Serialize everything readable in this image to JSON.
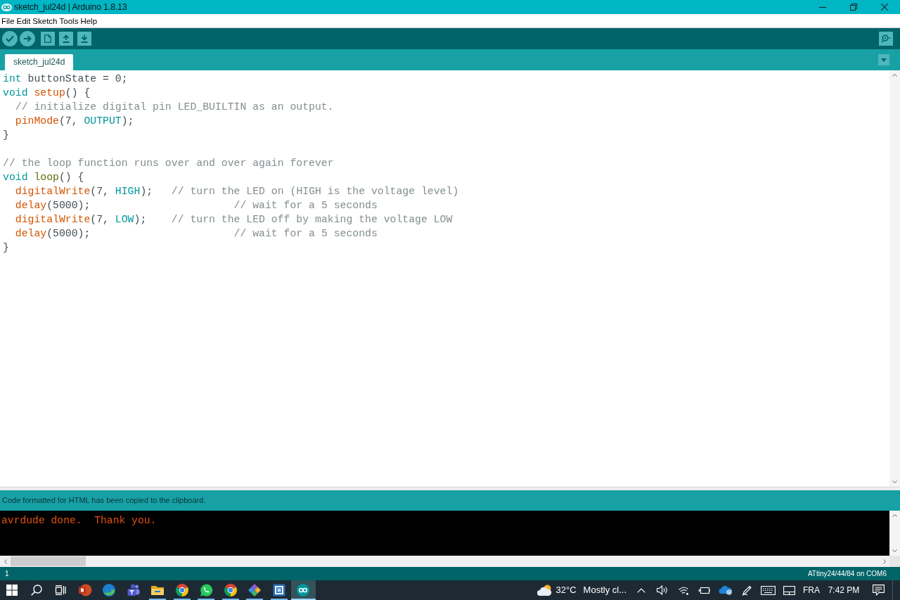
{
  "window": {
    "title": "sketch_jul24d | Arduino 1.8.13"
  },
  "menu": [
    "File",
    "Edit",
    "Sketch",
    "Tools",
    "Help"
  ],
  "tabs": [
    {
      "label": "sketch_jul24d",
      "selected": true
    }
  ],
  "editor": {
    "lines": [
      {
        "kind": "code",
        "tokens": [
          {
            "kind": "type",
            "text": "int"
          },
          {
            "kind": "plain",
            "text": " buttonState = 0;"
          }
        ]
      },
      {
        "kind": "code",
        "tokens": [
          {
            "kind": "type",
            "text": "void "
          },
          {
            "kind": "function",
            "text": "setup"
          },
          {
            "kind": "plain",
            "text": "() {"
          }
        ]
      },
      {
        "kind": "code",
        "tokens": [
          {
            "kind": "comment",
            "text": "  // initialize digital pin LED_BUILTIN as an output."
          }
        ]
      },
      {
        "kind": "code",
        "tokens": [
          {
            "kind": "function",
            "text": "  pinMode"
          },
          {
            "kind": "plain",
            "text": "(7, "
          },
          {
            "kind": "constant",
            "text": "OUTPUT"
          },
          {
            "kind": "plain",
            "text": ");"
          }
        ]
      },
      {
        "kind": "code",
        "tokens": [
          {
            "kind": "plain",
            "text": "}"
          }
        ]
      },
      {
        "kind": "blank"
      },
      {
        "kind": "code",
        "tokens": [
          {
            "kind": "comment",
            "text": "// the loop function runs over and over again forever"
          }
        ]
      },
      {
        "kind": "code",
        "tokens": [
          {
            "kind": "type",
            "text": "void "
          },
          {
            "kind": "structure",
            "text": "loop"
          },
          {
            "kind": "plain",
            "text": "() {"
          }
        ]
      },
      {
        "kind": "code",
        "tokens": [
          {
            "kind": "function",
            "text": "  digitalWrite"
          },
          {
            "kind": "plain",
            "text": "(7, "
          },
          {
            "kind": "constant",
            "text": "HIGH"
          },
          {
            "kind": "plain",
            "text": ");   "
          },
          {
            "kind": "comment",
            "text": "// turn the LED on (HIGH is the voltage level)"
          }
        ]
      },
      {
        "kind": "code",
        "tokens": [
          {
            "kind": "function",
            "text": "  delay"
          },
          {
            "kind": "plain",
            "text": "(5000);                       "
          },
          {
            "kind": "comment",
            "text": "// wait for a 5 seconds"
          }
        ]
      },
      {
        "kind": "code",
        "tokens": [
          {
            "kind": "function",
            "text": "  digitalWrite"
          },
          {
            "kind": "plain",
            "text": "(7, "
          },
          {
            "kind": "constant",
            "text": "LOW"
          },
          {
            "kind": "plain",
            "text": ");    "
          },
          {
            "kind": "comment",
            "text": "// turn the LED off by making the voltage LOW"
          }
        ]
      },
      {
        "kind": "code",
        "tokens": [
          {
            "kind": "function",
            "text": "  delay"
          },
          {
            "kind": "plain",
            "text": "(5000);                       "
          },
          {
            "kind": "comment",
            "text": "// wait for a 5 seconds"
          }
        ]
      },
      {
        "kind": "code",
        "tokens": [
          {
            "kind": "plain",
            "text": "}"
          }
        ]
      }
    ]
  },
  "message": "Code formatted for HTML has been copied to the clipboard.",
  "console": {
    "lines": [
      "avrdude done.  Thank you."
    ]
  },
  "status_bar": {
    "line": "1",
    "board": "ATtiny24/44/84 on COM6"
  },
  "taskbar": {
    "apps": [
      {
        "kind": "presentation",
        "running": false,
        "active": false
      },
      {
        "kind": "swirl",
        "running": false,
        "active": false
      },
      {
        "kind": "people",
        "running": false,
        "active": false
      },
      {
        "kind": "folder",
        "running": true,
        "active": false
      },
      {
        "kind": "ring",
        "running": true,
        "active": false
      },
      {
        "kind": "chat",
        "running": true,
        "active": false
      },
      {
        "kind": "ring",
        "running": true,
        "active": false
      },
      {
        "kind": "diamond",
        "running": true,
        "active": false
      },
      {
        "kind": "frame",
        "running": true,
        "active": false
      },
      {
        "kind": "infinity",
        "running": true,
        "active": true
      }
    ],
    "weather": {
      "temperature": "32°C",
      "condition": "Mostly cl..."
    },
    "language": "FRA",
    "clock": "7:42 PM"
  }
}
